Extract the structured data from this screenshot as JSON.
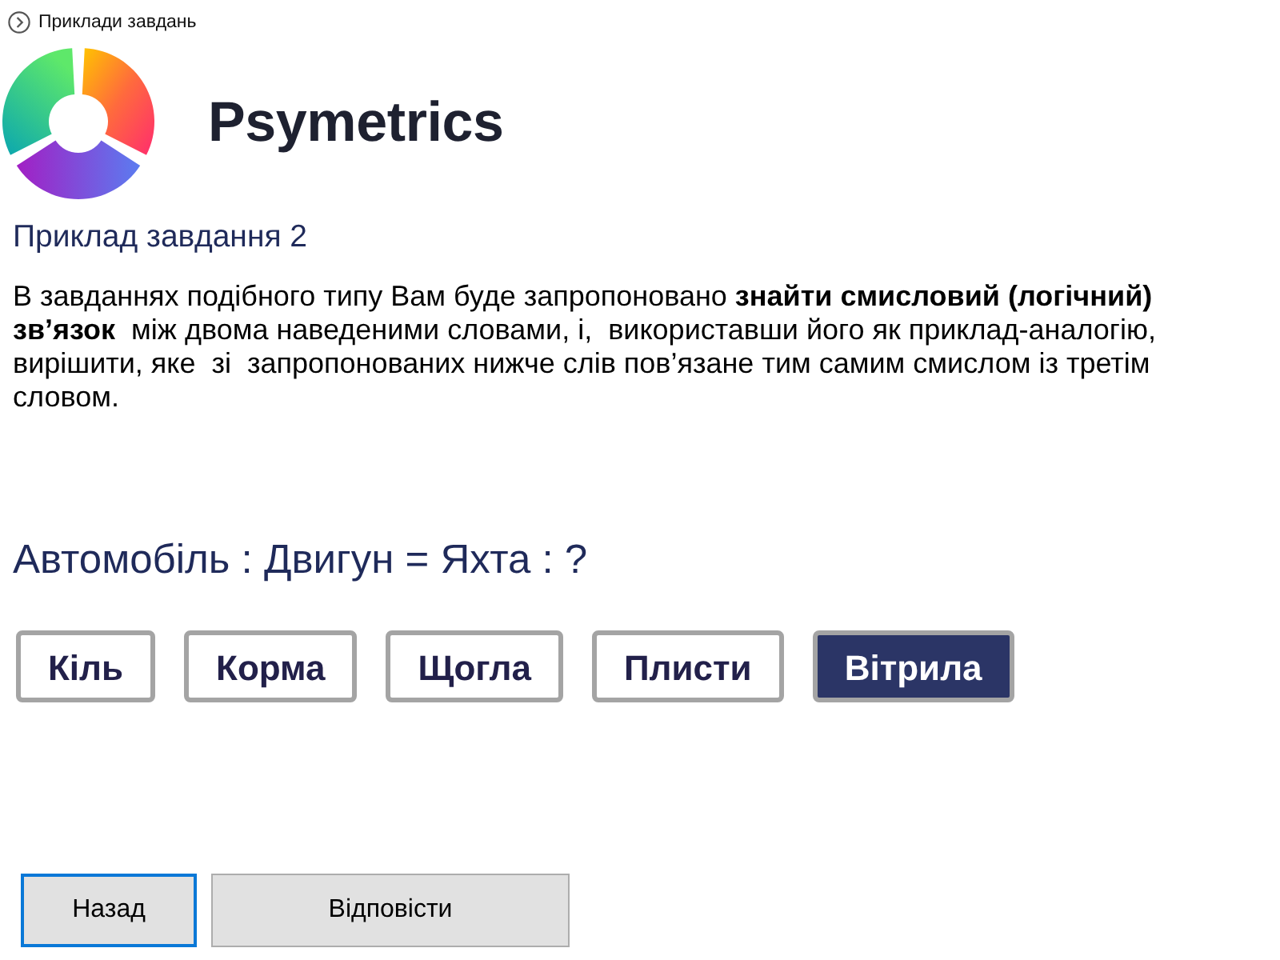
{
  "nav_link": {
    "label": "Приклади завдань"
  },
  "logo": {
    "name": "Psymetrics"
  },
  "task": {
    "title": "Приклад завдання 2",
    "instructions": "В завданнях подібного типу Вам буде запропоновано **знайти смисловий (логічний) зв’язок**  між двома наведеними словами, і,  використавши його як приклад-аналогію, вирішити, яке  зі  запропонованих нижче слів пов’язане тим самим смислом із третім словом.",
    "question": "Автомобіль : Двигун = Яхта : ?",
    "options": [
      {
        "label": "Кіль",
        "selected": false
      },
      {
        "label": "Корма",
        "selected": false
      },
      {
        "label": "Щогла",
        "selected": false
      },
      {
        "label": "Плисти",
        "selected": false
      },
      {
        "label": "Вітрила",
        "selected": true
      }
    ]
  },
  "actions": [
    {
      "label": "Назад",
      "kind": "back",
      "focused": true
    },
    {
      "label": "Відповісти",
      "kind": "submit",
      "focused": false
    }
  ]
}
